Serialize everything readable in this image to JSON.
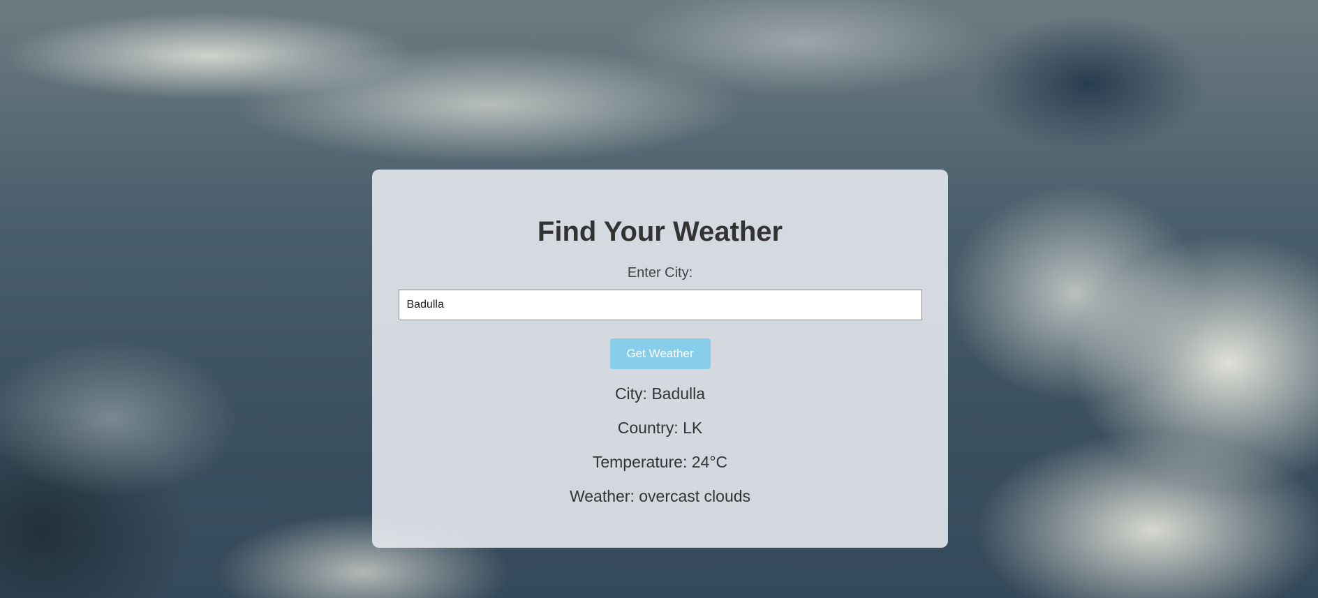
{
  "page": {
    "title": "Find Your Weather"
  },
  "form": {
    "city_label": "Enter City:",
    "city_value": "Badulla",
    "submit_label": "Get Weather"
  },
  "result": {
    "city": "City: Badulla",
    "country": "Country: LK",
    "temperature": "Temperature: 24°C",
    "weather": "Weather: overcast clouds"
  },
  "colors": {
    "card_background": "#e8ecf0",
    "title_text": "#333333",
    "button_background": "#87ceeb",
    "button_text": "#ffffff"
  }
}
